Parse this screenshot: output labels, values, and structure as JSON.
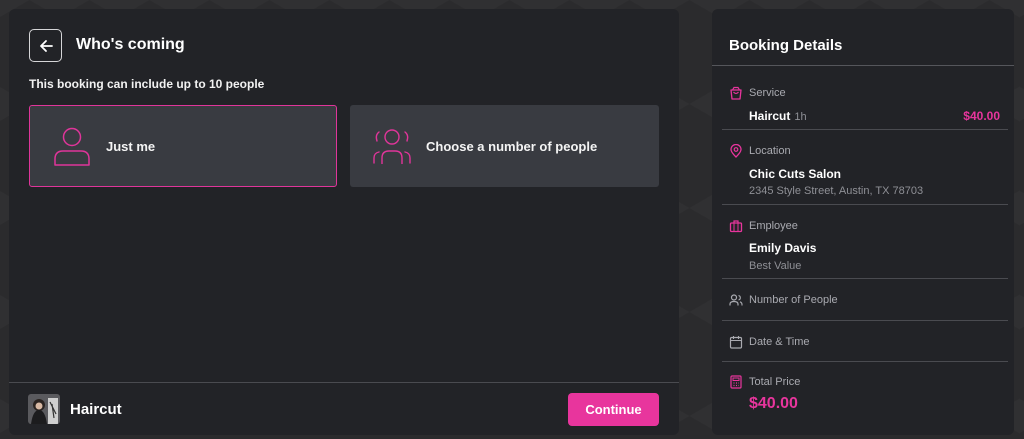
{
  "main": {
    "title": "Who's coming",
    "subtitle": "This booking can include up to 10 people",
    "options": [
      {
        "label": "Just me",
        "selected": true,
        "icon": "person-icon"
      },
      {
        "label": "Choose a number of people",
        "selected": false,
        "icon": "group-icon"
      }
    ],
    "footer": {
      "service_name": "Haircut",
      "continue_label": "Continue"
    }
  },
  "details": {
    "title": "Booking Details",
    "service": {
      "label": "Service",
      "name": "Haircut",
      "duration": "1h",
      "price": "$40.00"
    },
    "location": {
      "label": "Location",
      "name": "Chic Cuts Salon",
      "address": "2345 Style Street, Austin, TX 78703"
    },
    "employee": {
      "label": "Employee",
      "name": "Emily Davis",
      "tag": "Best Value"
    },
    "people": {
      "label": "Number of People"
    },
    "datetime": {
      "label": "Date & Time"
    },
    "total": {
      "label": "Total Price",
      "value": "$40.00"
    }
  },
  "colors": {
    "accent": "#e8359d",
    "panel": "#222327",
    "card": "#393b41",
    "background": "#2b2b2d"
  }
}
